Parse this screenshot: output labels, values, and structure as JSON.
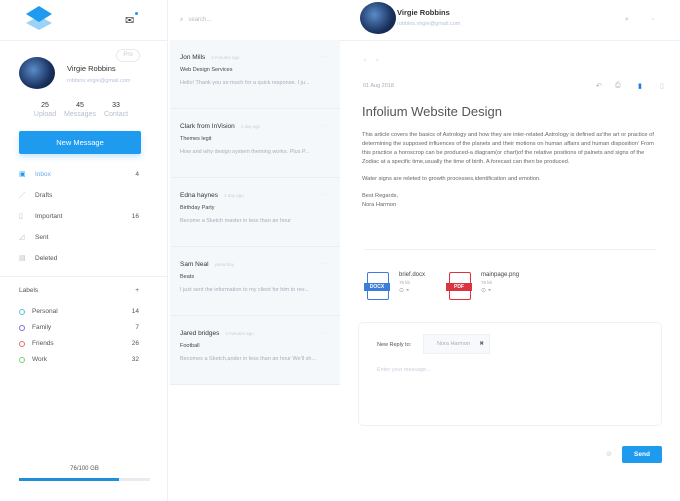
{
  "sidebar": {
    "profile": {
      "name": "Virgie Robbins",
      "email": "robbins.virgie@gmail.com",
      "badge": "Pro"
    },
    "stats": [
      {
        "value": "25",
        "label": "Upload"
      },
      {
        "value": "45",
        "label": "Messages"
      },
      {
        "value": "33",
        "label": "Contact"
      }
    ],
    "new_message": "New Message",
    "nav": [
      {
        "label": "Inbox",
        "count": "4",
        "icon": "inbox-icon"
      },
      {
        "label": "Drafts",
        "count": "",
        "icon": "pencil-icon"
      },
      {
        "label": "Important",
        "count": "16",
        "icon": "bookmark-icon"
      },
      {
        "label": "Sent",
        "count": "",
        "icon": "send-icon"
      },
      {
        "label": "Deleted",
        "count": "",
        "icon": "trash-icon"
      }
    ],
    "labels_title": "Labels",
    "labels_add": "+",
    "labels": [
      {
        "label": "Personal",
        "count": "14",
        "color": "#5bc0de"
      },
      {
        "label": "Family",
        "count": "7",
        "color": "#7b6fd6"
      },
      {
        "label": "Friends",
        "count": "26",
        "color": "#e36d6d"
      },
      {
        "label": "Work",
        "count": "32",
        "color": "#6fd67b"
      }
    ],
    "storage": {
      "text": "76/100 GB",
      "fraction": 0.76
    }
  },
  "list": {
    "search_placeholder": "search...",
    "items": [
      {
        "name": "Jon Mills",
        "time": "3 minutes ago",
        "subject": "Web Design Services",
        "preview": "Hello! Thank you so much for a quick response. I ju..."
      },
      {
        "name": "Clark from InVision",
        "time": "1 day ago",
        "subject": "Themes legit",
        "preview": "How and why design system theming works. Plus P..."
      },
      {
        "name": "Edna haynes",
        "time": "1 day ago",
        "subject": "Birthday Party",
        "preview": "Become a Sketch master in less than an hour"
      },
      {
        "name": "Sam Neal",
        "time": "yesterday",
        "subject": "Beats",
        "preview": "I just sent the information to my client for him to rev..."
      },
      {
        "name": "Jared bridges",
        "time": "3 minutes ago",
        "subject": "Football",
        "preview": "Becomes a Sketch,ander in less than an hour We'll sh..."
      }
    ]
  },
  "main": {
    "header": {
      "name": "Virgie Robbins",
      "email": "robbins.virgie@gmail.com"
    },
    "date": "01 Aug 2018",
    "title": "Infolium Website Design",
    "body": [
      "This article covers the basics of Astrology and how they are inter-related.Astrology is defined as'the art or practice of determining the supposed influences of the planets and their motions on human affairs and human disposition' From this practice a horoscrop can be produced-a diagram(or chart)of the relative positions of palnets and signs of the Zodiac at a specific time,usually the time of birth. A forecast can then be produced.",
      "Water signs are releted to growth processes,identification and emotion."
    ],
    "signoff": "Best Regards,",
    "signature": "Nora Harmon",
    "attachments": [
      {
        "name": "brief.docx",
        "size": "76 kb",
        "type": "DOCX",
        "color": "#3b7dd8"
      },
      {
        "name": "mainpage.png",
        "size": "76 kb",
        "type": "PDF",
        "color": "#d9343f"
      }
    ],
    "reply": {
      "label": "New Reply to:",
      "recipient": "Nora Harmon",
      "placeholder": "Enter your message..."
    },
    "send": "Send"
  }
}
